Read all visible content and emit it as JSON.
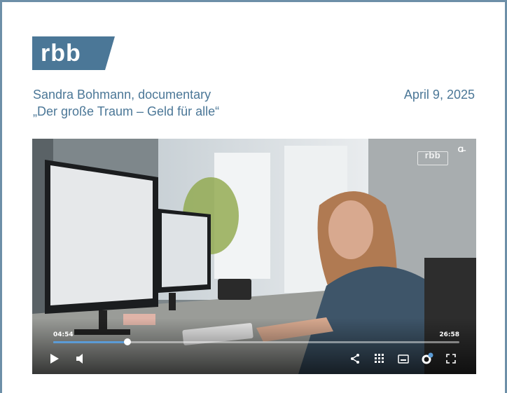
{
  "brand": {
    "logo_text": "rbb",
    "logo_color": "#4b7797"
  },
  "article": {
    "byline_line1": "Sandra Bohmann, documentary",
    "byline_line2": "„Der große Traum – Geld für alle“",
    "date": "April 9, 2025"
  },
  "player": {
    "watermark": "rbb",
    "ad_icon": "Ɑ̶",
    "current_time": "04:54",
    "duration": "26:58",
    "progress_fraction": 0.182,
    "accent": "#5b9bd5",
    "controls": [
      {
        "name": "play-icon"
      },
      {
        "name": "volume-icon"
      },
      {
        "name": "share-icon"
      },
      {
        "name": "chapters-grid-icon"
      },
      {
        "name": "subtitles-icon"
      },
      {
        "name": "settings-icon"
      },
      {
        "name": "fullscreen-icon"
      }
    ]
  }
}
